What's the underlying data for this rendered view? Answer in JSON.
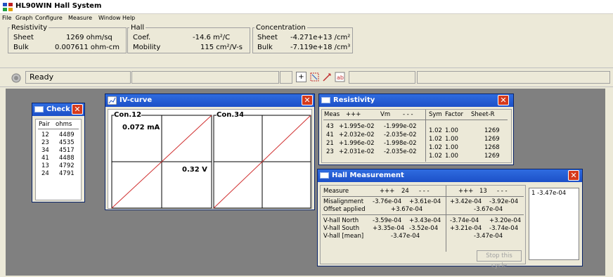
{
  "app": {
    "title": "HL90WIN Hall System"
  },
  "menu": [
    "File",
    "Graph",
    "Configure",
    "Measure",
    "Window",
    "Help"
  ],
  "info": {
    "resistivity": {
      "legend": "Resistivity",
      "sheet_label": "Sheet",
      "sheet_value": "1269 ohm/sq",
      "bulk_label": "Bulk",
      "bulk_value": "0.007611 ohm-cm"
    },
    "hall": {
      "legend": "Hall",
      "coef_label": "Coef.",
      "coef_value": "-14.6 m²/C",
      "mobility_label": "Mobility",
      "mobility_value": "115 cm²/V-s"
    },
    "concentration": {
      "legend": "Concentration",
      "sheet_label": "Sheet",
      "sheet_value": "-4.271e+13 /cm²",
      "bulk_label": "Bulk",
      "bulk_value": "-7.119e+18 /cm³"
    }
  },
  "status": {
    "text": "Ready",
    "icon": "status-icon"
  },
  "check": {
    "title": "Check",
    "headers": [
      "Pair",
      "ohms"
    ],
    "rows": [
      [
        "12",
        "4489"
      ],
      [
        "23",
        "4535"
      ],
      [
        "34",
        "4517"
      ],
      [
        "41",
        "4488"
      ],
      [
        "13",
        "4792"
      ],
      [
        "24",
        "4791"
      ]
    ]
  },
  "iv": {
    "title": "IV-curve",
    "left_label": "Con.12",
    "right_label": "Con.34",
    "current": "0.072 mA",
    "voltage": "0.32 V"
  },
  "resistivity": {
    "title": "Resistivity",
    "headers": [
      "Meas",
      "+++",
      "Vm",
      "- - -",
      "Sym",
      "Factor",
      "Sheet-R"
    ],
    "rows": [
      [
        "43",
        "+1.995e-02",
        "-1.999e-02",
        "1.02",
        "1.00",
        "1269"
      ],
      [
        "41",
        "+2.032e-02",
        "-2.035e-02",
        "1.02",
        "1.00",
        "1269"
      ],
      [
        "21",
        "+1.996e-02",
        "-1.998e-02",
        "1.02",
        "1.00",
        "1268"
      ],
      [
        "23",
        "+2.031e-02",
        "-2.035e-02",
        "1.02",
        "1.00",
        "1269"
      ]
    ]
  },
  "hall_meas": {
    "title": "Hall Measurement",
    "headers": [
      "Measure",
      "+++",
      "24",
      "- - -",
      "+++",
      "13",
      "- - -"
    ],
    "misalign": {
      "label": "Misalignment",
      "a": "-3.76e-04",
      "b": "+3.61e-04",
      "c": "+3.42e-04",
      "d": "-3.92e-04"
    },
    "offset": {
      "label": "Offset applied",
      "a": "+3.67e-04",
      "b": "-3.67e-04"
    },
    "north": {
      "label": "V-hall North",
      "a": "-3.59e-04",
      "b": "+3.43e-04",
      "c": "-3.74e-04",
      "d": "+3.20e-04"
    },
    "south": {
      "label": "V-hall South",
      "a": "+3.35e-04",
      "b": "-3.52e-04",
      "c": "+3.21e-04",
      "d": "-3.74e-04"
    },
    "mean": {
      "label": "V-hall [mean]",
      "a": "-3.47e-04",
      "b": "-3.47e-04"
    },
    "stop": "Stop this cycle",
    "list_item": "1 -3.47e-04"
  }
}
